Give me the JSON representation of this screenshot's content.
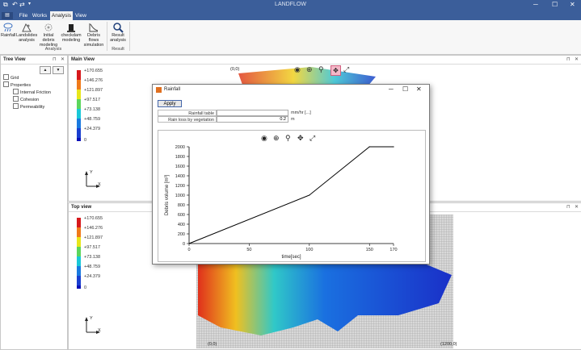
{
  "app": {
    "title": "LANDFLOW"
  },
  "tabs": [
    {
      "label": "File"
    },
    {
      "label": "Works"
    },
    {
      "label": "Analysis"
    },
    {
      "label": "View"
    }
  ],
  "ribbon": {
    "buttons": [
      {
        "label1": "Rainfall",
        "label2": "",
        "icon": "rain-icon"
      },
      {
        "label1": "Landslides",
        "label2": "analysis",
        "icon": "landslide-icon"
      },
      {
        "label1": "Initial debris",
        "label2": "modeling",
        "icon": "debris-icon"
      },
      {
        "label1": "checkdam",
        "label2": "modeling",
        "icon": "checkdam-icon"
      },
      {
        "label1": "Debris flows",
        "label2": "simulation",
        "icon": "debris-flow-icon"
      },
      {
        "label1": "Result",
        "label2": "analysis",
        "icon": "magnifier-icon"
      }
    ],
    "groups": {
      "analysis": "Analysis",
      "result": "Result"
    }
  },
  "tree_view": {
    "title": "Tree View",
    "up_label": "▲",
    "down_label": "▼",
    "items": [
      {
        "label": "Grid"
      },
      {
        "label": "Properties"
      },
      {
        "label": "Internal Friction"
      },
      {
        "label": "Cohesion"
      },
      {
        "label": "Permeability"
      }
    ]
  },
  "main_view": {
    "title": "Main View",
    "corner_label": "(0,0)"
  },
  "top_view": {
    "title": "Top view",
    "corner_label": "(0,0)",
    "corner_label_right": "(1200,0)"
  },
  "legend": {
    "values": [
      "+170.655",
      "+146.276",
      "+121.897",
      "+97.517",
      "+73.138",
      "+48.759",
      "+24.379",
      "0"
    ],
    "colors": [
      "#d7191c",
      "#f07a1a",
      "#e8e61a",
      "#5cd65c",
      "#1ac8d8",
      "#1a7ae0",
      "#1a3fd0",
      "#0a10b8"
    ]
  },
  "axes_indicator": {
    "y": "Y",
    "x": "X"
  },
  "dialog": {
    "title": "Rainfall",
    "apply_label": "Apply",
    "rows": [
      {
        "label": "Rainfall table",
        "value": "",
        "unit": "mm/hr [...]"
      },
      {
        "label": "Rain loss by vegetation",
        "value": "0.2",
        "unit": "m"
      }
    ]
  },
  "chart_data": {
    "type": "line",
    "title": "",
    "xlabel": "time[sec]",
    "ylabel": "Debris volume [m³]",
    "x": [
      0,
      100,
      150,
      170
    ],
    "series": [
      {
        "values": [
          0,
          1000,
          2000,
          2000
        ]
      }
    ],
    "xlim": [
      0,
      170
    ],
    "ylim": [
      0,
      2000
    ],
    "xticks": [
      0,
      50,
      100,
      150,
      170
    ],
    "yticks": [
      0,
      200,
      400,
      600,
      800,
      1000,
      1200,
      1400,
      1600,
      1800,
      2000
    ],
    "grid": false,
    "color": "#000000"
  }
}
